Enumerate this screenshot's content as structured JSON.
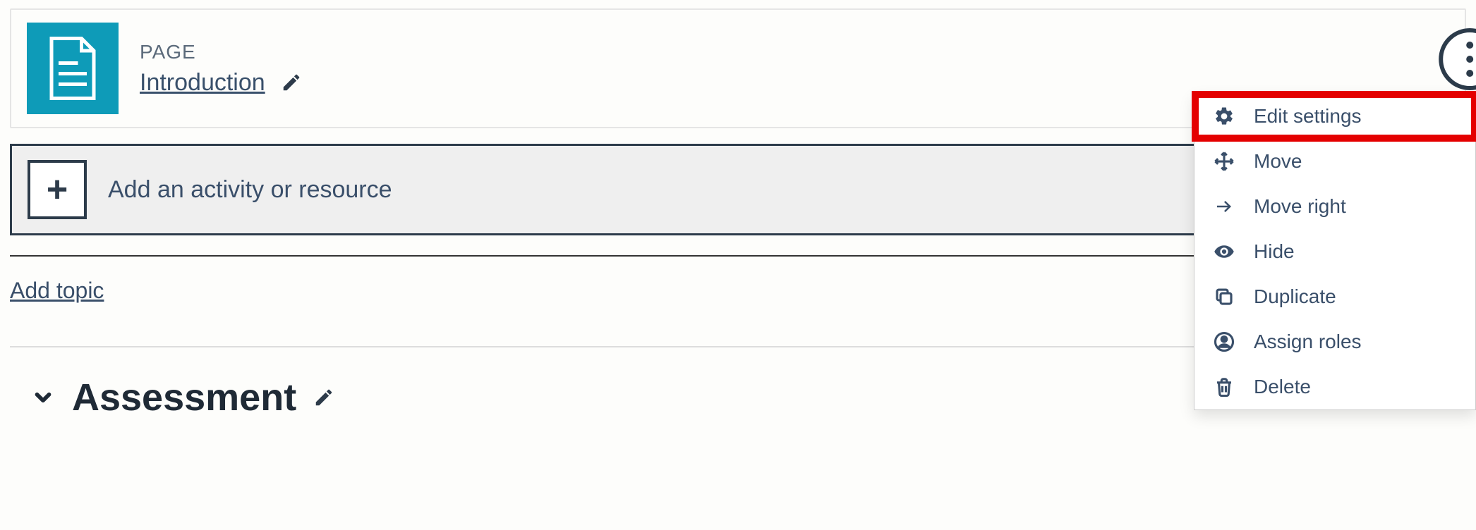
{
  "activity": {
    "type_label": "PAGE",
    "title": "Introduction"
  },
  "add_bar": {
    "label": "Add an activity or resource"
  },
  "links": {
    "add_topic": "Add topic"
  },
  "section": {
    "title": "Assessment"
  },
  "menu": {
    "items": [
      {
        "icon": "gear",
        "label": "Edit settings",
        "highlight": true
      },
      {
        "icon": "move",
        "label": "Move"
      },
      {
        "icon": "arrow-right",
        "label": "Move right"
      },
      {
        "icon": "eye",
        "label": "Hide"
      },
      {
        "icon": "duplicate",
        "label": "Duplicate"
      },
      {
        "icon": "user",
        "label": "Assign roles"
      },
      {
        "icon": "trash",
        "label": "Delete"
      }
    ]
  }
}
